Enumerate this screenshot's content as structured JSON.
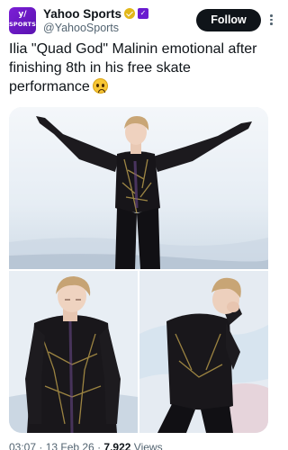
{
  "account": {
    "display_name": "Yahoo Sports",
    "handle": "@YahooSports",
    "avatar_text": "SPORTS",
    "avatar_mark": "y/",
    "verified_color": "#e2b719",
    "affiliate_badge_color": "#6a1bd0"
  },
  "actions": {
    "follow_label": "Follow"
  },
  "tweet": {
    "text": "Ilia \"Quad God\" Malinin emotional after finishing 8th in his free skate performance",
    "emoji": "pleading-face-emoji"
  },
  "media": {
    "count": 3,
    "photos": [
      {
        "name": "skater-arms-raised-photo"
      },
      {
        "name": "skater-looking-down-photo"
      },
      {
        "name": "skater-hand-over-face-photo"
      }
    ]
  },
  "footer": {
    "time": "03:07 · 13 Feb 26 ·",
    "views_count": "7,922",
    "views_label": "Views"
  }
}
